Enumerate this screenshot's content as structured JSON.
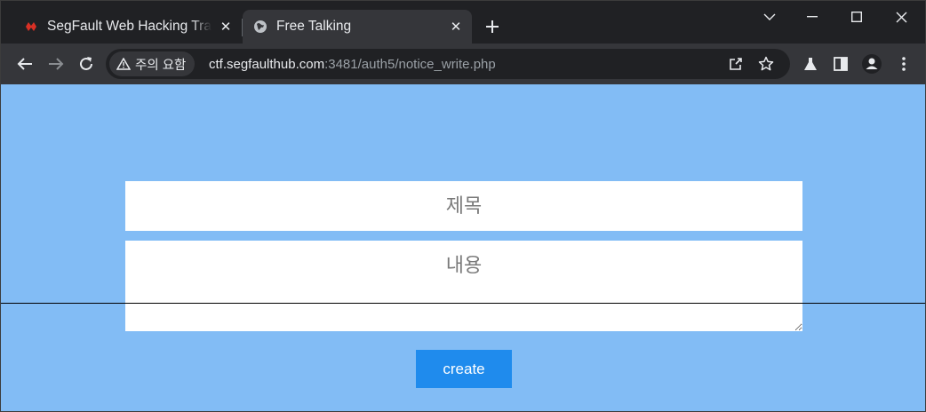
{
  "browser": {
    "tabs": [
      {
        "title": "SegFault Web Hacking Training",
        "favicon": "segfault-logo-icon",
        "active": false
      },
      {
        "title": "Free Talking",
        "favicon": "globe-icon",
        "active": true
      }
    ],
    "security_chip": "주의 요함",
    "url_host": "ctf.segfaulthub.com",
    "url_rest": ":3481/auth5/notice_write.php"
  },
  "form": {
    "title_placeholder": "제목",
    "content_placeholder": "내용",
    "create_label": "create"
  },
  "colors": {
    "page_background": "#82bcf5",
    "button_background": "#1f8bed",
    "browser_frame": "#202124",
    "toolbar": "#35363a"
  }
}
